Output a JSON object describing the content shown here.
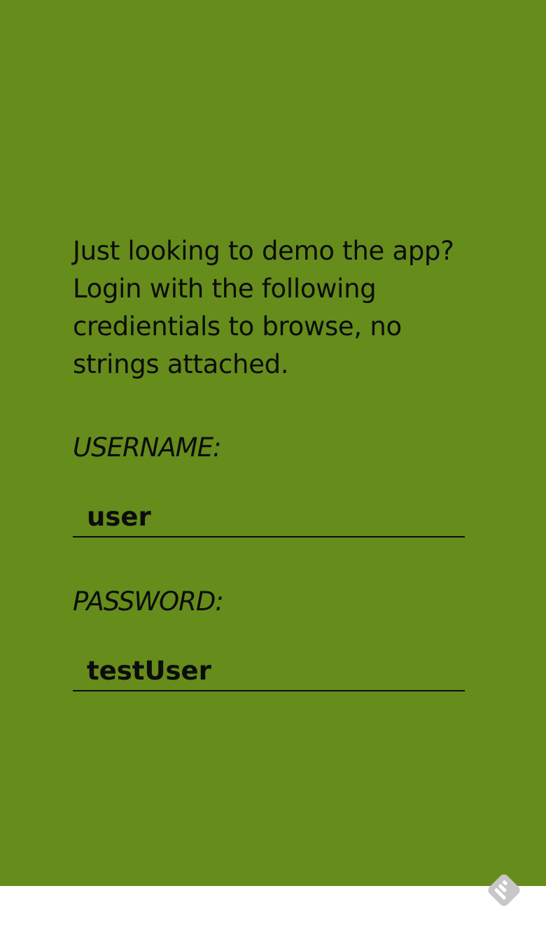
{
  "intro": {
    "text": "Just looking to demo the app? Login with the following credientials to browse, no strings attached."
  },
  "username": {
    "label": "USERNAME:",
    "value": "user"
  },
  "password": {
    "label": "PASSWORD:",
    "value": "testUser"
  },
  "colors": {
    "background": "#668c1b",
    "text": "#0c0c0c",
    "footer": "#ffffff",
    "icon": "#c7c7c7"
  },
  "icons": {
    "corner": "feedly-icon"
  }
}
